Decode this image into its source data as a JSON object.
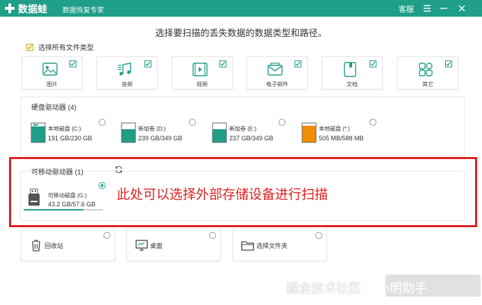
{
  "app": {
    "brand": "数据蛙",
    "subtitle": "数据恢复专家",
    "support_label": "客服",
    "accent_color": "#1f9e88"
  },
  "main": {
    "heading": "选择要扫描的丢失数据的数据类型和路径。",
    "select_all_label": "选择所有文件类型",
    "select_all_checked": true,
    "file_types": [
      {
        "label": "图片",
        "icon": "image-icon",
        "checked": true
      },
      {
        "label": "音频",
        "icon": "music-icon",
        "checked": true
      },
      {
        "label": "视频",
        "icon": "video-icon",
        "checked": true
      },
      {
        "label": "电子邮件",
        "icon": "email-icon",
        "checked": true
      },
      {
        "label": "文档",
        "icon": "document-icon",
        "checked": true
      },
      {
        "label": "其它",
        "icon": "other-icon",
        "checked": true
      }
    ]
  },
  "hard_drives": {
    "title": "硬盘驱动器 (4)",
    "items": [
      {
        "name": "本地磁盘 (C:)",
        "size": "191 GB/230 GB",
        "used_fraction": 0.83,
        "color": "#1f9e88",
        "windows": true
      },
      {
        "name": "新加卷 (D:)",
        "size": "239 GB/349 GB",
        "used_fraction": 0.68,
        "color": "#1f9e88",
        "windows": false
      },
      {
        "name": "新加卷 (E:)",
        "size": "237 GB/349 GB",
        "used_fraction": 0.68,
        "color": "#1f9e88",
        "windows": false
      },
      {
        "name": "本地磁盘 (*:)",
        "size": "505 MB/588 MB",
        "used_fraction": 0.86,
        "color": "#f08c00",
        "windows": false
      }
    ]
  },
  "removable": {
    "title": "可移动驱动器 (1)",
    "drive_name": "可移动磁盘 (G:)",
    "drive_size": "43.2 GB/57.6 GB",
    "used_fraction": 0.75,
    "selected": true
  },
  "annotation": "此处可以选择外部存储设备进行扫描",
  "locations": [
    {
      "label": "回收站",
      "icon": "recycle-bin-icon"
    },
    {
      "label": "桌面",
      "icon": "desktop-icon"
    },
    {
      "label": "选择文件夹",
      "icon": "folder-icon"
    }
  ],
  "watermark": {
    "part1": "掘金技术社区",
    "part2": "@ 小明助手"
  }
}
